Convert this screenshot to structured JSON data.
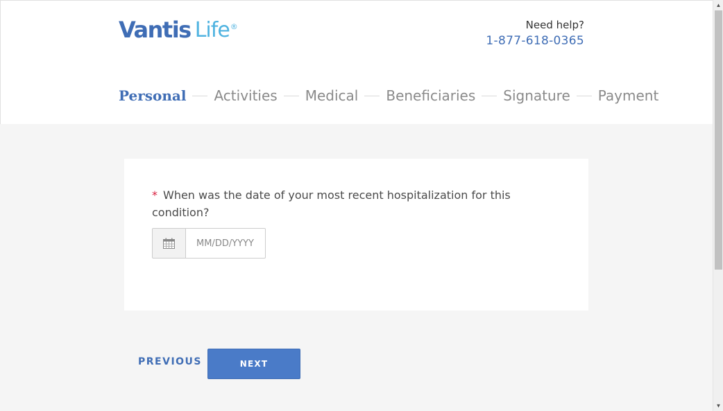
{
  "brand": {
    "name_bold": "Vantis",
    "name_light": "Life",
    "registered": "®",
    "color_primary": "#3f6db5",
    "color_accent": "#4fb3e0"
  },
  "help": {
    "label": "Need help?",
    "phone": "1-877-618-0365"
  },
  "steps": [
    {
      "label": "Personal",
      "active": true
    },
    {
      "label": "Activities",
      "active": false
    },
    {
      "label": "Medical",
      "active": false
    },
    {
      "label": "Beneficiaries",
      "active": false
    },
    {
      "label": "Signature",
      "active": false
    },
    {
      "label": "Payment",
      "active": false
    }
  ],
  "question": {
    "required_mark": "*",
    "text": "When was the date of your most recent hospitalization for this condition?",
    "date_placeholder": "MM/DD/YYYY",
    "date_icon": "calendar-icon"
  },
  "nav": {
    "previous_label": "PREVIOUS",
    "next_label": "NEXT"
  }
}
